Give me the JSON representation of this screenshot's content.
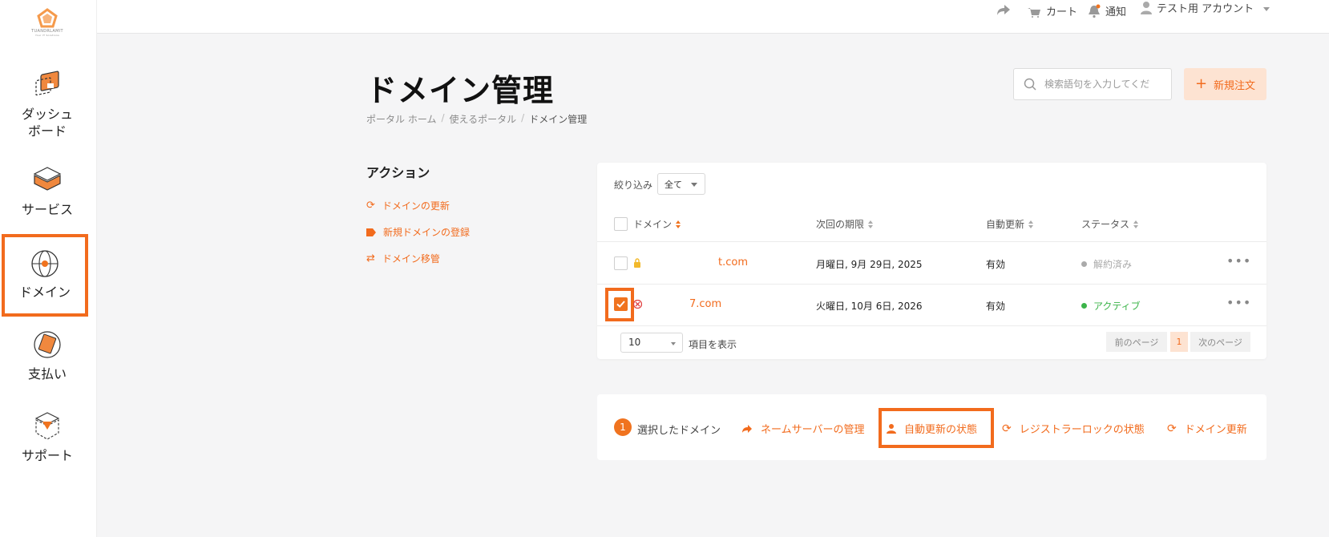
{
  "brand": {
    "logo_text": "TUANDRLAMIT",
    "logo_sub": "Your IT Solutions",
    "accent": "#f26b1d"
  },
  "sidebar": {
    "items": [
      {
        "label": "ダッシュボード",
        "icon": "dashboard-icon"
      },
      {
        "label": "サービス",
        "icon": "service-box-icon"
      },
      {
        "label": "ドメイン",
        "icon": "globe-icon",
        "active": true
      },
      {
        "label": "支払い",
        "icon": "payment-icon"
      },
      {
        "label": "サポート",
        "icon": "support-icon"
      }
    ]
  },
  "topbar": {
    "cart": "カート",
    "notifications": "通知",
    "account": "テスト用 アカウント"
  },
  "header": {
    "title": "ドメイン管理",
    "breadcrumb": [
      "ポータル ホーム",
      "使えるポータル",
      "ドメイン管理"
    ],
    "search_placeholder": "検索語句を入力してくだ",
    "new_order": "新規注文"
  },
  "actions": {
    "title": "アクション",
    "items": [
      "ドメインの更新",
      "新規ドメインの登録",
      "ドメイン移管"
    ]
  },
  "table": {
    "filter_label": "絞り込み",
    "filter_value": "全て",
    "columns": [
      "ドメイン",
      "次回の期限",
      "自動更新",
      "ステータス"
    ],
    "rows": [
      {
        "checked": false,
        "domain": "t.com",
        "due": "月曜日, 9月 29日, 2025",
        "auto_renew": "有効",
        "status": "解約済み",
        "status_color": "#aaaaaa"
      },
      {
        "checked": true,
        "domain": "7.com",
        "due": "火曜日, 10月 6日, 2026",
        "auto_renew": "有効",
        "status": "アクティブ",
        "status_color": "#3cb44a"
      }
    ],
    "per_page": "10",
    "per_page_label": "項目を表示",
    "prev": "前のページ",
    "page": "1",
    "next": "次のページ"
  },
  "bulk": {
    "count": "1",
    "selected_label": "選択したドメイン",
    "actions": [
      "ネームサーバーの管理",
      "自動更新の状態",
      "レジストラーロックの状態",
      "ドメイン更新"
    ]
  }
}
